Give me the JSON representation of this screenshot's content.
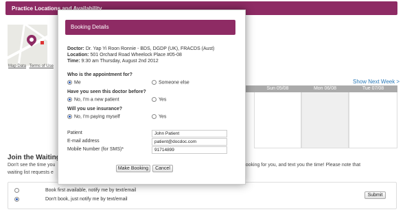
{
  "header": {
    "title": "Practice Locations and Availability"
  },
  "map": {
    "links": [
      "Map Data",
      "Terms of Use"
    ]
  },
  "calendar": {
    "show_next": "Show Next Week >",
    "days": [
      "Sun 05/08",
      "Mon 06/08",
      "Tue 07/08"
    ]
  },
  "waiting_list": {
    "title": "Join the Waiting List",
    "desc_left": "Don't see the time you",
    "desc_right": "e booking for you, and text you the time! Please note that",
    "desc_line2": "waiting list requests e",
    "options": [
      "Book first available, notify me by text/email",
      "Don't book, just notify me by text/email"
    ],
    "selected_index": 1,
    "submit_label": "Submit"
  },
  "booking": {
    "title": "Booking Details",
    "doctor_label": "Doctor:",
    "doctor_value": "Dr. Yap Yi Roon Ronnie - BDS, DGDP (UK), FRACDS (Aust)",
    "location_label": "Location:",
    "location_value": "501 Orchard Road Wheelock Place #05-08",
    "time_label": "Time:",
    "time_value": "9:30 am Thursday, August 2nd 2012",
    "q1": {
      "text": "Who is the appointment for?",
      "opt_a": "Me",
      "opt_b": "Someone else",
      "selected": "a"
    },
    "q2": {
      "text": "Have you seen this doctor before?",
      "opt_a": "No, I'm a new patient",
      "opt_b": "Yes",
      "selected": "a"
    },
    "q3": {
      "text": "Will you use insurance?",
      "opt_a": "No, I'm paying myself",
      "opt_b": "Yes",
      "selected": "a"
    },
    "fields": {
      "patient_label": "Patient",
      "patient_value": "John Patient",
      "email_label": "E-mail address",
      "email_value": "patient@docdoc.com",
      "mobile_label": "Mobile Number (for SMS)*",
      "mobile_value": "91714899"
    },
    "make_booking_label": "Make Booking",
    "cancel_label": "Cancel"
  }
}
